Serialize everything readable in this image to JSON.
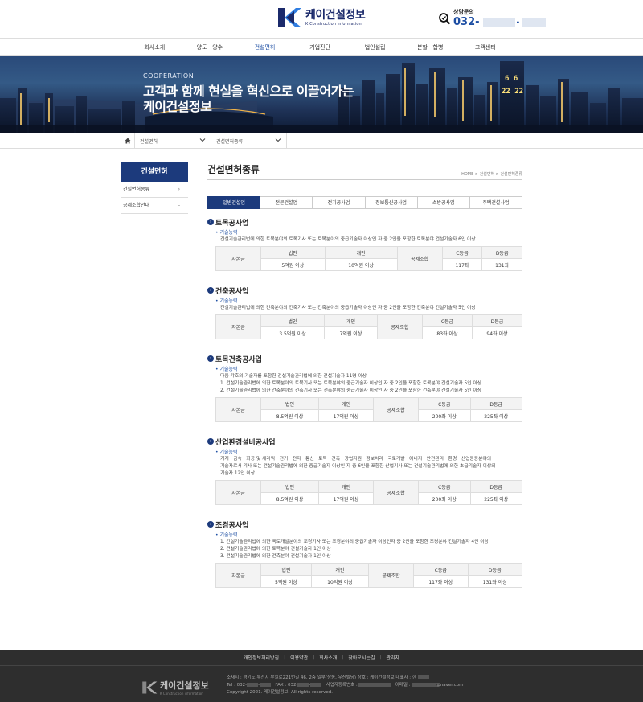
{
  "header": {
    "logo_ko": "케이건설정보",
    "logo_en": "K Construction information",
    "consult_label": "상담문의",
    "consult_phone": "032-",
    "consult_phone_sep": "-"
  },
  "nav": [
    "회사소개",
    "양도 · 양수",
    "건설면허",
    "기업진단",
    "법인설립",
    "분할 · 합병",
    "고객센터"
  ],
  "banner": {
    "sub": "COOPERATION",
    "title_line1": "고객과 함께 현실을 혁신으로 이끌어가는",
    "title_line2": "케이건설정보",
    "clock_top": "6  6",
    "clock_bottom": "22 22"
  },
  "locbar": {
    "sel1": "건설면허",
    "sel2": "건설면허종류"
  },
  "sidebar": {
    "title": "건설면허",
    "items": [
      {
        "label": "건설면허종류",
        "arrow": "›"
      },
      {
        "label": "공제조합안내",
        "arrow": "-"
      }
    ]
  },
  "main": {
    "title": "건설면허종류",
    "breadcrumb": "HOME > 건설면허 > 건설면허종류",
    "tabs": [
      "일반건설업",
      "전문건설업",
      "전기공사업",
      "정보통신공사업",
      "소방공사업",
      "주택건설사업"
    ]
  },
  "table_labels": {
    "capital": "자본금",
    "corp": "법인",
    "indiv": "개인",
    "union": "공제조합",
    "c_grade": "C등급",
    "d_grade": "D등급"
  },
  "sections": [
    {
      "title": "토목공사업",
      "sub": "기술능력",
      "desc": [
        "건설기술관리법에 의한 토목분야의 토목기사 또는 토목분야의 중급기술자 이상인 자 중 2인을 포함한 토목분야 건설기술자 6인 이상"
      ],
      "corp": "5억원 이상",
      "indiv": "10억원 이상",
      "c": "117좌",
      "d": "131좌"
    },
    {
      "title": "건축공사업",
      "sub": "기술능력",
      "desc": [
        "건설기술관리법에 의한 건축분야의 건축기사 또는 건축분야의 중급기술자 이상인 자 중 2인을 포함한 건축분야 건설기술자 5인 이상"
      ],
      "corp": "3.5억원 이상",
      "indiv": "7억원 이상",
      "c": "83좌 이상",
      "d": "94좌 이상"
    },
    {
      "title": "토목건축공사업",
      "sub": "기술능력",
      "desc": [
        "다음 각호의 기술자를 포함한 건설기술관리법에 의한 건설기술자 11명 이상",
        "1. 건설기술관리법에 의한 토목분야의 토목기사 또는 토목분야의 중급기술자 이상인 자 중 2인을 포함한 토목분야 건설기술자 5인 이상",
        "2. 건설기술관리법에 의한 건축분야의 건축기사 또는 건축분야의 중급기술자 이상인 자 중 2인을 포함한 건축분야 건설기술자 5인 이상"
      ],
      "corp": "8.5억원 이상",
      "indiv": "17억원 이상",
      "c": "200좌 이상",
      "d": "225좌 이상"
    },
    {
      "title": "산업환경설비공사업",
      "sub": "기술능력",
      "desc": [
        "기계 · 금속 · 화공 및 세라믹 · 전기 · 전자 · 통신 · 토목 · 건축 · 광업자원 · 정보처리 · 국토개발 · 에너지 · 안전관리 · 환경 · 산업응용분야의",
        "기술자로서 기사 또는 건설기술관리법에 의한 중급기술자 이상인 자 중 6인을 포함한 산업기사 또는 건설기술관리법에 의한 초급기술자 이상의",
        "기술자 12인 이상"
      ],
      "corp": "8.5억원 이상",
      "indiv": "17억원 이상",
      "c": "200좌 이상",
      "d": "225좌 이상"
    },
    {
      "title": "조경공사업",
      "sub": "기술능력",
      "desc": [
        "1. 건설기술관리법에 의한 국토개발분야의 조경기사 또는 조경분야의 중급기술자 이상인자 중 2인을 포함한 조경분야 건설기술자 4인 이상",
        "2. 건설기술관리법에 의한 토목분야 건설기술자 1인 이상",
        "3. 건설기술관리법에 의한 건축분야 건설기술자 1인 이상"
      ],
      "corp": "5억원 이상",
      "indiv": "10억원 이상",
      "c": "117좌 이상",
      "d": "131좌 이상"
    }
  ],
  "footer": {
    "links": [
      "개인정보처리방침",
      "이용약관",
      "회사소개",
      "찾아오시는길",
      "관리자"
    ],
    "logo_ko": "케이건설정보",
    "logo_en": "K Construction information",
    "line1": "소재지 : 경기도 부천시 부일로221번길 46, 2층 일부(상동, 우신빌딩)   상호 : 케이건설정보   대표자 : 한",
    "line2_tel": "Tel : 032-",
    "line2_fax": "FAX : 032-",
    "line2_biz": "사업자등록번호 :",
    "line2_mail_label": "이메일 :",
    "line2_mail": "@naver.com",
    "line3": "Copyright 2021. 케이건설정보.  All rights reserved."
  },
  "colors": {
    "brand": "#1c3a7c",
    "accent": "#1d4ea3",
    "footer_bg": "#2e2e2e"
  }
}
